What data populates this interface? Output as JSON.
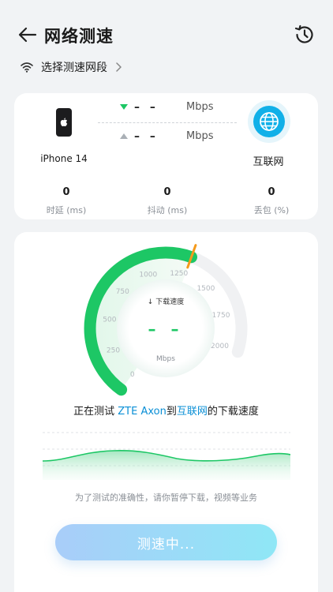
{
  "header": {
    "title": "网络测速"
  },
  "segment": {
    "label": "选择测速网段"
  },
  "device": {
    "name": "iPhone 14"
  },
  "network": {
    "name": "互联网"
  },
  "rates": {
    "download": {
      "value": "– –",
      "unit": "Mbps"
    },
    "upload": {
      "value": "– –",
      "unit": "Mbps"
    }
  },
  "stats": [
    {
      "value": "0",
      "label": "时延 (ms)"
    },
    {
      "value": "0",
      "label": "抖动 (ms)"
    },
    {
      "value": "0",
      "label": "丢包 (%)"
    }
  ],
  "gauge": {
    "ticks": [
      "0",
      "250",
      "500",
      "750",
      "1000",
      "1250",
      "1500",
      "1750",
      "2000"
    ],
    "title": "↓ 下载速度",
    "value": "– –",
    "unit": "Mbps",
    "max": 2000,
    "progress_value": 1300
  },
  "status": {
    "prefix": "正在测试 ",
    "device": "ZTE Axon",
    "mid": "到",
    "target": "互联网",
    "suffix": "的下载速度"
  },
  "hint": "为了测试的准确性，请你暂停下载，视频等业务",
  "button": {
    "label": "测速中..."
  },
  "colors": {
    "accent_green": "#1dc765",
    "accent_blue": "#0a8fd6",
    "needle": "#f59a1b"
  }
}
